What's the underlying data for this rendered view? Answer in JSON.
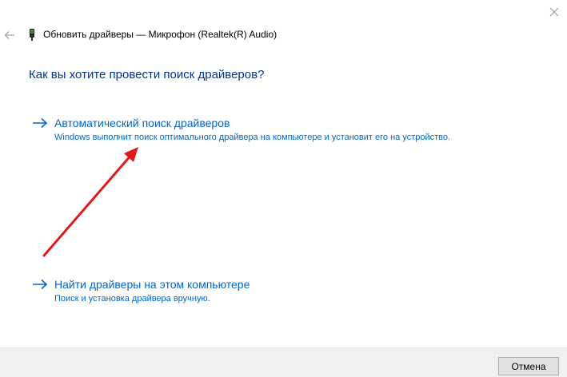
{
  "window": {
    "title": "Обновить драйверы — Микрофон (Realtek(R) Audio)",
    "close_icon": "close-icon",
    "back_icon": "back-arrow-icon",
    "device_icon": "device-icon"
  },
  "main": {
    "heading": "Как вы хотите провести поиск драйверов?",
    "options": [
      {
        "title": "Автоматический поиск драйверов",
        "description": "Windows выполнит поиск оптимального драйвера на компьютере и установит его на устройство."
      },
      {
        "title": "Найти драйверы на этом компьютере",
        "description": "Поиск и установка драйвера вручную."
      }
    ]
  },
  "footer": {
    "cancel_label": "Отмена"
  },
  "colors": {
    "heading": "#003399",
    "link": "#0066cc",
    "annotation": "#e0191b",
    "footer_bg": "#f0f0f0"
  }
}
